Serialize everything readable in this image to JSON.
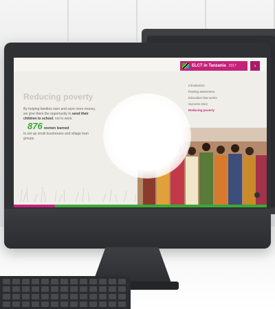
{
  "header": {
    "title": "ELCT in Tanzania",
    "year": "2017",
    "next_icon": "›"
  },
  "section": {
    "heading": "Reducing poverty",
    "paragraph_start": "By helping families earn and save more money, we give them the opportunity to ",
    "paragraph_bold": "send their children to school",
    "paragraph_end": ", not to work.",
    "stat_number": "876",
    "stat_label": "women learned",
    "stat_detail": "to set up small businesses and village loan groups"
  },
  "menu": {
    "items": [
      {
        "label": "Introduction",
        "active": false
      },
      {
        "label": "Raising awareness",
        "active": false
      },
      {
        "label": "Education that works",
        "active": false
      },
      {
        "label": "Success story",
        "active": false
      },
      {
        "label": "Reducing poverty",
        "active": true
      }
    ]
  },
  "colors": {
    "accent": "#c4237a",
    "green": "#3aa935",
    "heading_gray": "#c9c6bd"
  }
}
